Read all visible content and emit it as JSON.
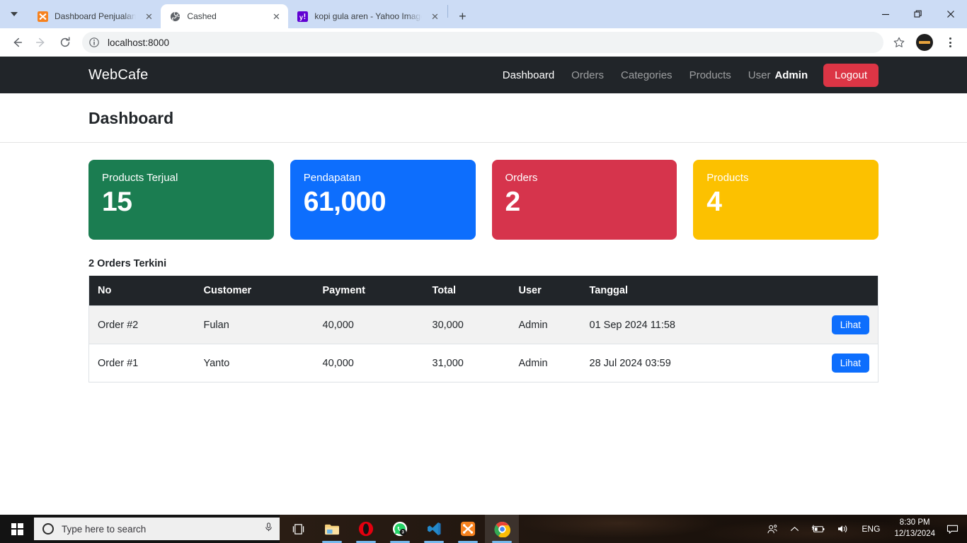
{
  "browser": {
    "tabs": [
      {
        "title": "Dashboard Penjualan",
        "icon": "xampp-icon",
        "active": false
      },
      {
        "title": "Cashed",
        "icon": "globe-icon",
        "active": true
      },
      {
        "title": "kopi gula aren - Yahoo Image S",
        "icon": "yahoo-icon",
        "active": false
      }
    ],
    "new_tab_label": "+",
    "window_controls": {
      "minimize": "—",
      "maximize": "❐",
      "close": "✕"
    },
    "toolbar": {
      "back": "←",
      "forward": "→",
      "reload": "↻",
      "url": "localhost:8000",
      "bookmark": "☆"
    }
  },
  "navbar": {
    "brand": "WebCafe",
    "links": [
      {
        "label": "Dashboard",
        "active": true
      },
      {
        "label": "Orders",
        "active": false
      },
      {
        "label": "Categories",
        "active": false
      },
      {
        "label": "Products",
        "active": false
      }
    ],
    "user_label": "User",
    "user_name": "Admin",
    "logout_label": "Logout"
  },
  "page": {
    "title": "Dashboard"
  },
  "cards": [
    {
      "label": "Products Terjual",
      "value": "15",
      "color": "#1b7d51"
    },
    {
      "label": "Pendapatan",
      "value": "61,000",
      "color": "#0d6efd"
    },
    {
      "label": "Orders",
      "value": "2",
      "color": "#d6344c"
    },
    {
      "label": "Products",
      "value": "4",
      "color": "#fcc100"
    }
  ],
  "orders": {
    "title": "2 Orders Terkini",
    "columns": [
      "No",
      "Customer",
      "Payment",
      "Total",
      "User",
      "Tanggal"
    ],
    "action_label": "Lihat",
    "rows": [
      {
        "no": "Order #2",
        "customer": "Fulan",
        "payment": "40,000",
        "total": "30,000",
        "user": "Admin",
        "tanggal": "01 Sep 2024 11:58"
      },
      {
        "no": "Order #1",
        "customer": "Yanto",
        "payment": "40,000",
        "total": "31,000",
        "user": "Admin",
        "tanggal": "28 Jul 2024 03:59"
      }
    ]
  },
  "taskbar": {
    "search_placeholder": "Type here to search",
    "apps": [
      {
        "name": "task-view",
        "badge": ""
      },
      {
        "name": "file-explorer",
        "badge": ""
      },
      {
        "name": "opera",
        "badge": ""
      },
      {
        "name": "whatsapp",
        "badge": "3"
      },
      {
        "name": "vscode",
        "badge": ""
      },
      {
        "name": "xampp",
        "badge": ""
      },
      {
        "name": "chrome",
        "badge": ""
      }
    ],
    "tray": {
      "language": "ENG",
      "time": "8:30 PM",
      "date": "12/13/2024"
    }
  }
}
